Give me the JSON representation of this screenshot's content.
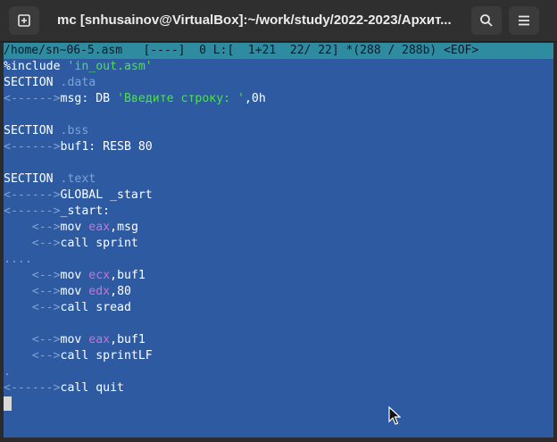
{
  "window": {
    "title": "mc [snhusainov@VirtualBox]:~/work/study/2022-2023/Архит..."
  },
  "status_bar": "/home/sn~06-5.asm   [----]  0 L:[  1+21  22/ 22] *(288 / 288b) <EOF>",
  "colors": {
    "editor_bg": "#2d5aa0",
    "status_bg": "#2f8ca0",
    "string": "#4ee04e",
    "register": "#d070d0",
    "tab_marker": "#7fa1d6"
  },
  "lines": [
    [
      {
        "t": "%include ",
        "c": "kw"
      },
      {
        "t": "'in_out.asm'",
        "c": "str"
      }
    ],
    [
      {
        "t": "SECTION ",
        "c": "kw"
      },
      {
        "t": ".data",
        "c": "sect"
      }
    ],
    [
      {
        "t": "<------>",
        "c": "tab"
      },
      {
        "t": "msg: DB ",
        "c": "kw"
      },
      {
        "t": "'Введите строку: '",
        "c": "str"
      },
      {
        "t": ",0h",
        "c": "kw"
      }
    ],
    [],
    [
      {
        "t": "SECTION ",
        "c": "kw"
      },
      {
        "t": ".bss",
        "c": "sect"
      }
    ],
    [
      {
        "t": "<------>",
        "c": "tab"
      },
      {
        "t": "buf1: RESB 80",
        "c": "kw"
      }
    ],
    [],
    [
      {
        "t": "SECTION ",
        "c": "kw"
      },
      {
        "t": ".text",
        "c": "sect"
      }
    ],
    [
      {
        "t": "<------>",
        "c": "tab"
      },
      {
        "t": "GLOBAL _start",
        "c": "kw"
      }
    ],
    [
      {
        "t": "<------>",
        "c": "tab"
      },
      {
        "t": "_start:",
        "c": "kw"
      }
    ],
    [
      {
        "t": "    <-->",
        "c": "tab"
      },
      {
        "t": "mov ",
        "c": "kw"
      },
      {
        "t": "eax",
        "c": "reg"
      },
      {
        "t": ",msg",
        "c": "kw"
      }
    ],
    [
      {
        "t": "    <-->",
        "c": "tab"
      },
      {
        "t": "call sprint",
        "c": "kw"
      }
    ],
    [
      {
        "t": "....",
        "c": "tab"
      }
    ],
    [
      {
        "t": "    <-->",
        "c": "tab"
      },
      {
        "t": "mov ",
        "c": "kw"
      },
      {
        "t": "ecx",
        "c": "reg"
      },
      {
        "t": ",buf1",
        "c": "kw"
      }
    ],
    [
      {
        "t": "    <-->",
        "c": "tab"
      },
      {
        "t": "mov ",
        "c": "kw"
      },
      {
        "t": "edx",
        "c": "reg"
      },
      {
        "t": ",80",
        "c": "kw"
      }
    ],
    [
      {
        "t": "    <-->",
        "c": "tab"
      },
      {
        "t": "call sread",
        "c": "kw"
      }
    ],
    [],
    [
      {
        "t": "    <-->",
        "c": "tab"
      },
      {
        "t": "mov ",
        "c": "kw"
      },
      {
        "t": "eax",
        "c": "reg"
      },
      {
        "t": ",buf1",
        "c": "kw"
      }
    ],
    [
      {
        "t": "    <-->",
        "c": "tab"
      },
      {
        "t": "call sprintLF",
        "c": "kw"
      }
    ],
    [
      {
        "t": ".",
        "c": "tab"
      }
    ],
    [
      {
        "t": "<------>",
        "c": "tab"
      },
      {
        "t": "call quit",
        "c": "kw"
      }
    ]
  ],
  "icons": {
    "new_tab": "new-tab-icon",
    "search": "search-icon",
    "menu": "hamburger-menu-icon",
    "pointer": "mouse-pointer-icon"
  }
}
